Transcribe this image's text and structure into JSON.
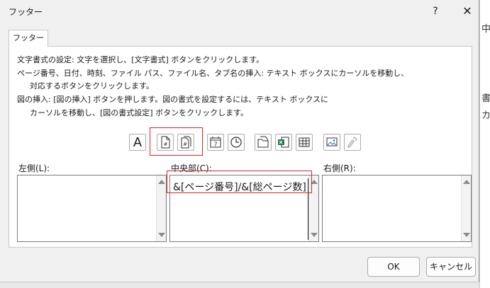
{
  "dialog": {
    "title": "フッター",
    "help": "?",
    "close": "✕"
  },
  "tab": {
    "label": "フッター"
  },
  "instructions": [
    "文字書式の設定: 文字を選択し、[文字書式] ボタンをクリックします。",
    "ページ番号、日付、時刻、ファイル パス、ファイル名、タブ名の挿入: テキスト ボックスにカーソルを移動し、",
    "対応するボタンをクリックします。",
    "図の挿入: [図の挿入] ボタンを押します。図の書式を設定するには、テキスト ボックスに",
    "カーソルを移動し、[図の書式設定] ボタンをクリックします。"
  ],
  "toolbar": {
    "format_text": "A",
    "date_number": "7"
  },
  "sections": {
    "left": {
      "label": "左側(L):",
      "content": ""
    },
    "center": {
      "label": "中央部(C):",
      "content": "&[ページ番号]/&[総ページ数]"
    },
    "right": {
      "label": "右側(R):",
      "content": ""
    }
  },
  "buttons": {
    "ok": "OK",
    "cancel": "キャンセル"
  },
  "background": {
    "cell_top": "中央",
    "cell_a": "書",
    "cell_b": "カ"
  },
  "colors": {
    "highlight": "#e0202a",
    "excel_green": "#1d7a43"
  }
}
